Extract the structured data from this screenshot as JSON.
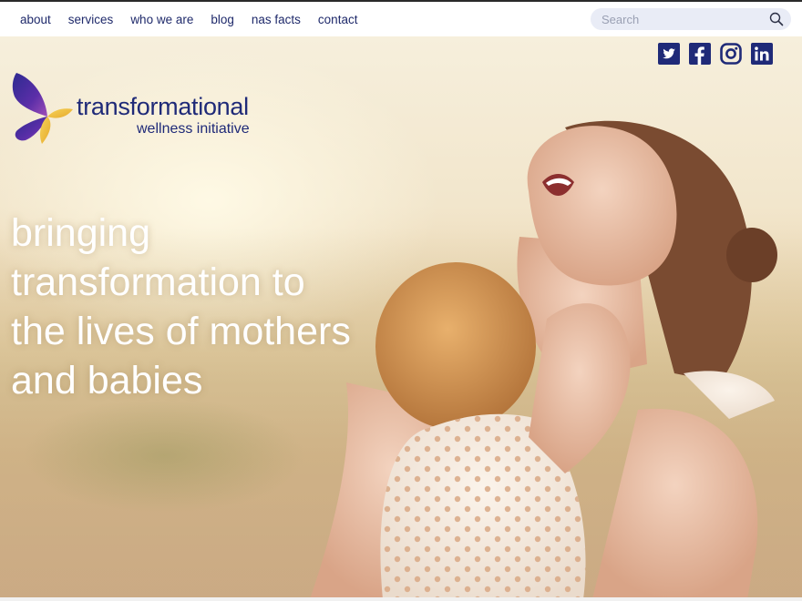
{
  "nav": {
    "links": [
      "about",
      "services",
      "who we are",
      "blog",
      "nas facts",
      "contact"
    ]
  },
  "search": {
    "placeholder": "Search",
    "value": ""
  },
  "social": [
    "twitter-icon",
    "facebook-icon",
    "instagram-icon",
    "linkedin-icon"
  ],
  "logo": {
    "title": "transformational",
    "subtitle": "wellness initiative"
  },
  "hero": {
    "tagline": [
      "bringing",
      "transformation to",
      "the lives of mothers",
      "and babies"
    ]
  },
  "colors": {
    "brand_navy": "#1f2a78",
    "nav_text": "#1f2a6b",
    "search_bg": "#e9ecf6",
    "butterfly_purple": "#4a2aa0",
    "butterfly_gold": "#f2c640"
  }
}
